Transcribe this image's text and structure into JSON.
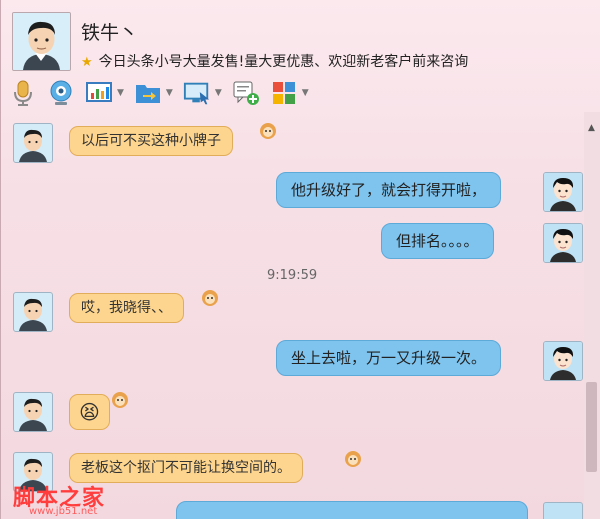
{
  "contact": {
    "name": "铁牛丶",
    "signature": "今日头条小号大量发售!量大更优惠、欢迎新老客户前来咨询"
  },
  "toolbar": [
    "microphone-icon",
    "webcam-icon",
    "whiteboard-icon",
    "send-file-icon",
    "remote-desktop-icon",
    "message-add-icon",
    "apps-icon"
  ],
  "chat": {
    "timestamp": "9:19:59",
    "messages": [
      {
        "side": "left",
        "text": "以后可不买这种小牌子"
      },
      {
        "side": "right",
        "text": "他升级好了，就会打得开啦，"
      },
      {
        "side": "right",
        "text": "但排名。。。。"
      },
      {
        "side": "left",
        "text": "哎，我晓得、、"
      },
      {
        "side": "right",
        "text": "坐上去啦，万一又升级一次。"
      },
      {
        "side": "left",
        "text": "😫"
      },
      {
        "side": "left",
        "text": "老板这个抠门不可能让换空间的。"
      }
    ]
  },
  "watermark": {
    "title": "脚本之家",
    "url": "www.jb51.net"
  },
  "colors": {
    "left_bubble": "#fdd58e",
    "right_bubble": "#7ec4ef",
    "background": "#f6dfe5"
  }
}
